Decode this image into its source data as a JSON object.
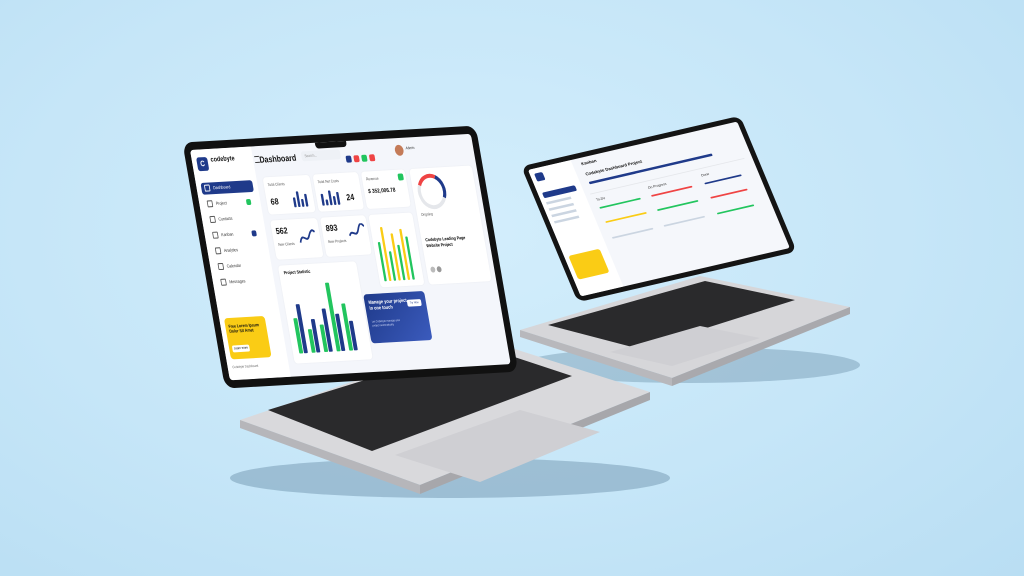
{
  "scene": {
    "background_color": "#c9e9fb",
    "laptop_color": "#d9d9dc",
    "keyboard_color": "#2a2a2c"
  },
  "laptop1": {
    "brand": {
      "name": "codebyte",
      "tagline": ""
    },
    "page_title": "Dashboard",
    "search_placeholder": "Search...",
    "user_name": "Admin",
    "nav": [
      {
        "label": "Dashboard",
        "icon": "grid-icon",
        "active": true
      },
      {
        "label": "Project",
        "icon": "folder-icon",
        "active": false
      },
      {
        "label": "Contacts",
        "icon": "phone-icon",
        "active": false
      },
      {
        "label": "Kanban",
        "icon": "board-icon",
        "active": false
      },
      {
        "label": "Analytics",
        "icon": "chart-icon",
        "active": false
      },
      {
        "label": "Calendar",
        "icon": "calendar-icon",
        "active": false
      },
      {
        "label": "Messages",
        "icon": "message-icon",
        "active": false
      }
    ],
    "promo": {
      "text": "Free Lorem Ipsum Dolor Sit Amet",
      "button": "Learn more"
    },
    "footer_text": "Codebyte Dashboard",
    "stats": [
      {
        "label": "Total Clients",
        "value": "68"
      },
      {
        "label": "Total Net Costs",
        "value": "24"
      },
      {
        "label": "Revenue",
        "value": "$ 352,006.78"
      },
      {
        "label": "New Clients",
        "value": "562"
      },
      {
        "label": "New Projects",
        "value": "893"
      }
    ],
    "gauge_label": "Ongoing",
    "side_card": {
      "title": "Codebyte Leading Page Website Project"
    },
    "chart_title": "Project Statistic",
    "manage": {
      "title": "Manage your project in one touch",
      "subtitle": "Let Codebyte manage your project automatically",
      "button": "Try Now"
    },
    "colors": {
      "primary": "#1f3a8a",
      "green": "#22c55e",
      "yellow": "#facc15",
      "red": "#ef4444"
    }
  },
  "laptop2": {
    "page_title": "Kanban",
    "headline": "Codebyte Dashboard Project",
    "column_labels": [
      "To-Do",
      "On Progress",
      "Done"
    ]
  }
}
